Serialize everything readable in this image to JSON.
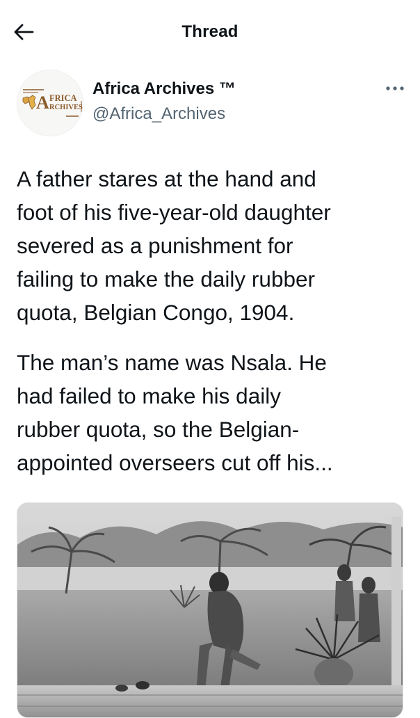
{
  "header": {
    "title": "Thread"
  },
  "tweet": {
    "author_name": "Africa Archives ™",
    "author_handle": "@Africa_Archives",
    "avatar_logo_text": "AFRICA ARCHIVES",
    "paragraphs": [
      "A father stares at the hand and\nfoot of his five-year-old daughter\nsevered as a punishment for\nfailing to make the daily rubber\nquota, Belgian Congo, 1904.",
      "The man’s name was Nsala. He\nhad failed to make his daily\nrubber quota, so the Belgian-\nappointed overseers cut off his..."
    ]
  },
  "icons": {
    "back": "arrow-left-icon",
    "more": "more-horizontal-icon"
  },
  "colors": {
    "text": "#0f1419",
    "secondary_text": "#536471",
    "logo_brown": "#8b5a2b",
    "background": "#ffffff"
  }
}
